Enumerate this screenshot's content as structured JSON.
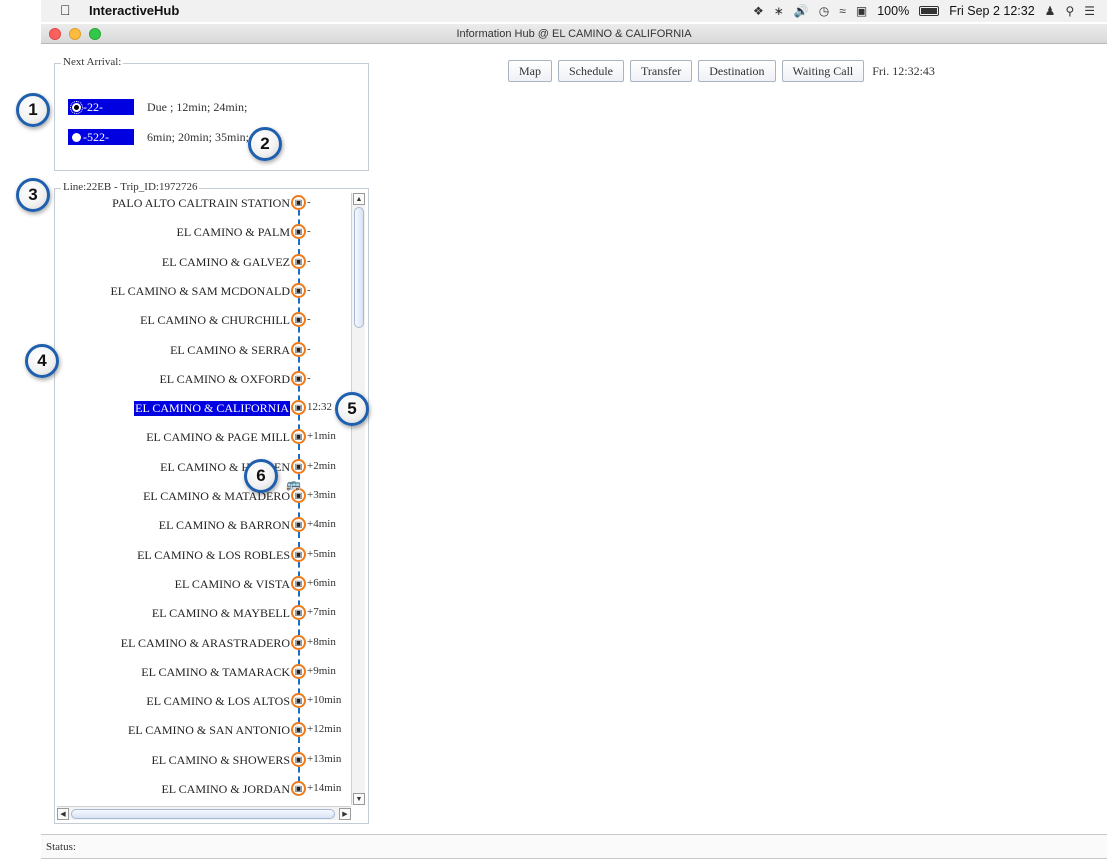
{
  "menubar": {
    "app_name": "InteractiveHub",
    "battery": "100%",
    "clock": "Fri Sep 2  12:32"
  },
  "window": {
    "title": "Information Hub @ EL CAMINO & CALIFORNIA"
  },
  "next_arrival": {
    "label": "Next Arrival:",
    "routes": [
      {
        "route": "-22-",
        "times": "Due ; 12min; 24min;",
        "selected": true
      },
      {
        "route": "-522-",
        "times": "6min; 20min; 35min;",
        "selected": false
      }
    ]
  },
  "trip": {
    "label": "Line:22EB - Trip_ID:1972726",
    "stops": [
      {
        "name": "PALO ALTO CALTRAIN STATION",
        "time": "-"
      },
      {
        "name": "EL CAMINO & PALM",
        "time": "-"
      },
      {
        "name": "EL CAMINO & GALVEZ",
        "time": "-"
      },
      {
        "name": "EL CAMINO & SAM MCDONALD",
        "time": "-"
      },
      {
        "name": "EL CAMINO & CHURCHILL",
        "time": "-"
      },
      {
        "name": "EL CAMINO & SERRA",
        "time": "-"
      },
      {
        "name": "EL CAMINO & OXFORD",
        "time": "-"
      },
      {
        "name": "EL CAMINO & CALIFORNIA",
        "time": "12:32",
        "selected": true
      },
      {
        "name": "EL CAMINO & PAGE MILL",
        "time": "+1min"
      },
      {
        "name": "EL CAMINO & HANSEN",
        "time": "+2min"
      },
      {
        "name": "EL CAMINO & MATADERO",
        "time": "+3min"
      },
      {
        "name": "EL CAMINO & BARRON",
        "time": "+4min"
      },
      {
        "name": "EL CAMINO & LOS ROBLES",
        "time": "+5min"
      },
      {
        "name": "EL CAMINO & VISTA",
        "time": "+6min"
      },
      {
        "name": "EL CAMINO & MAYBELL",
        "time": "+7min"
      },
      {
        "name": "EL CAMINO & ARASTRADERO",
        "time": "+8min"
      },
      {
        "name": "EL CAMINO & TAMARACK",
        "time": "+9min"
      },
      {
        "name": "EL CAMINO & LOS ALTOS",
        "time": "+10min"
      },
      {
        "name": "EL CAMINO & SAN ANTONIO",
        "time": "+12min"
      },
      {
        "name": "EL CAMINO & SHOWERS",
        "time": "+13min"
      },
      {
        "name": "EL CAMINO & JORDAN",
        "time": "+14min"
      }
    ]
  },
  "toolbar": {
    "buttons": [
      "Map",
      "Schedule",
      "Transfer",
      "Destination",
      "Waiting Call"
    ],
    "clock": "Fri. 12:32:43"
  },
  "status": {
    "label": "Status:"
  },
  "callouts": [
    "1",
    "2",
    "3",
    "4",
    "5",
    "6"
  ],
  "colors": {
    "selection": "#0000e0",
    "stop_ring": "#f07a1a",
    "track": "#1a6ec8",
    "callout_ring": "#1e5fae"
  }
}
